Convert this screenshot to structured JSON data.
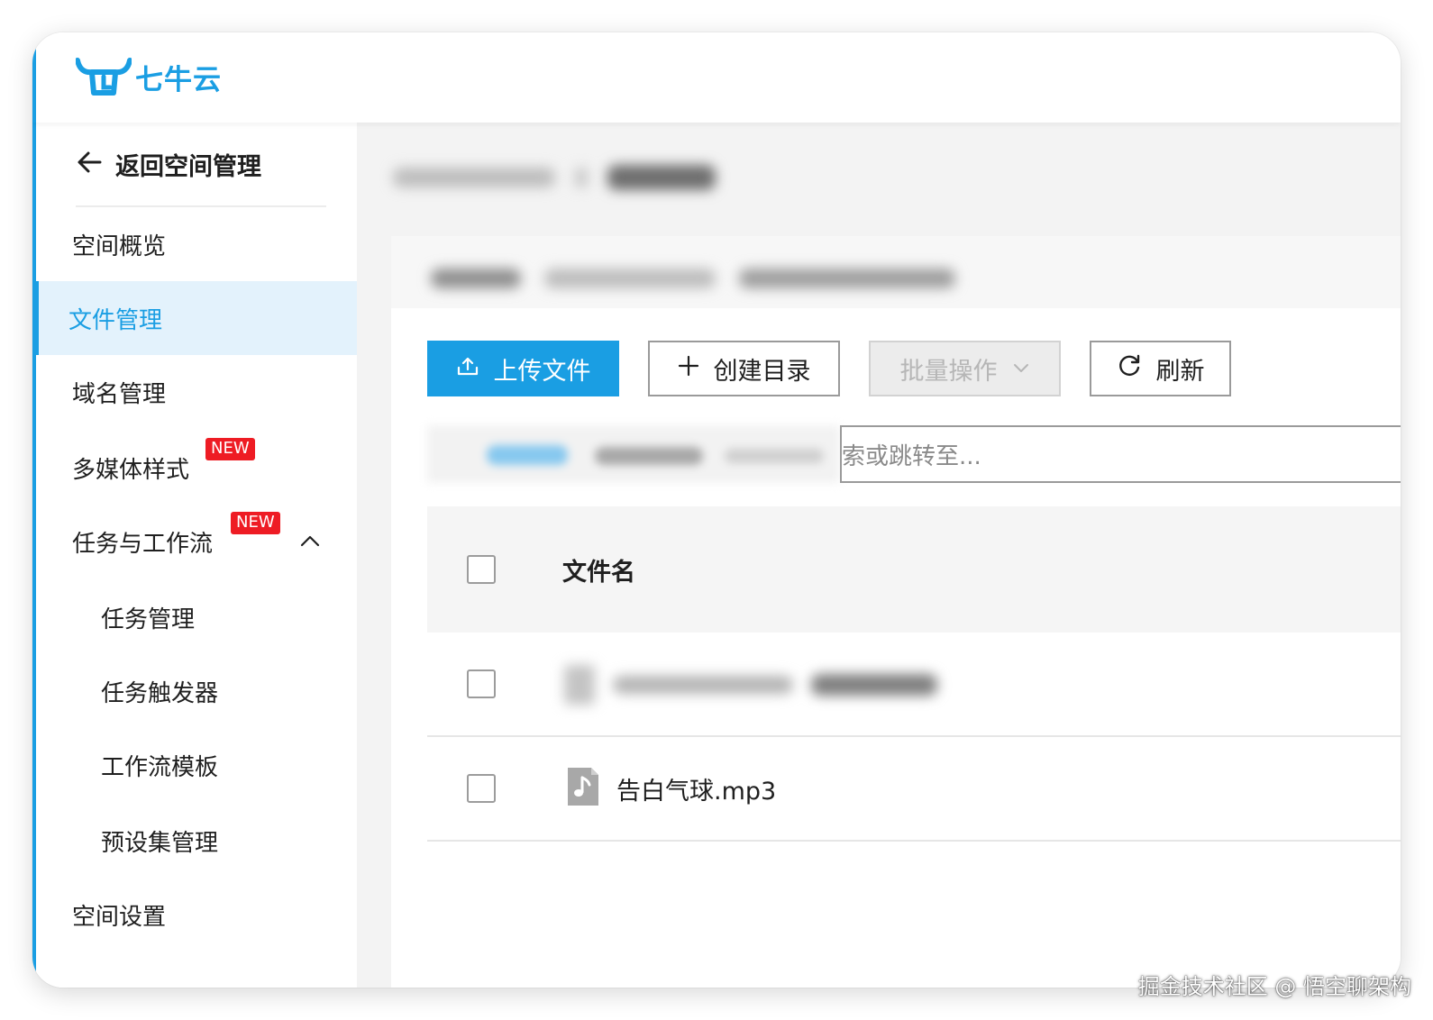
{
  "app": {
    "brand": "七牛云",
    "accent_color": "#1a9ee3",
    "badge_color": "#ee1c24"
  },
  "sidebar": {
    "back_label": "返回空间管理",
    "items": [
      {
        "label": "空间概览"
      },
      {
        "label": "文件管理",
        "active": true
      },
      {
        "label": "域名管理"
      },
      {
        "label": "多媒体样式",
        "badge": "NEW"
      },
      {
        "label": "任务与工作流",
        "badge": "NEW",
        "expanded": true
      },
      {
        "label": "任务管理",
        "sub": true
      },
      {
        "label": "任务触发器",
        "sub": true
      },
      {
        "label": "工作流模板",
        "sub": true
      },
      {
        "label": "预设集管理",
        "sub": true
      },
      {
        "label": "空间设置"
      }
    ]
  },
  "toolbar": {
    "upload_label": "上传文件",
    "create_dir_label": "创建目录",
    "batch_label": "批量操作",
    "refresh_label": "刷新"
  },
  "search": {
    "placeholder_visible": "索或跳转至..."
  },
  "table": {
    "column_name": "文件名",
    "rows": [
      {
        "name": "",
        "blurred": true
      },
      {
        "name": "告白气球.mp3",
        "type": "audio",
        "icon": "music-file-icon"
      }
    ]
  },
  "watermark": "掘金技术社区 @ 悟空聊架构"
}
